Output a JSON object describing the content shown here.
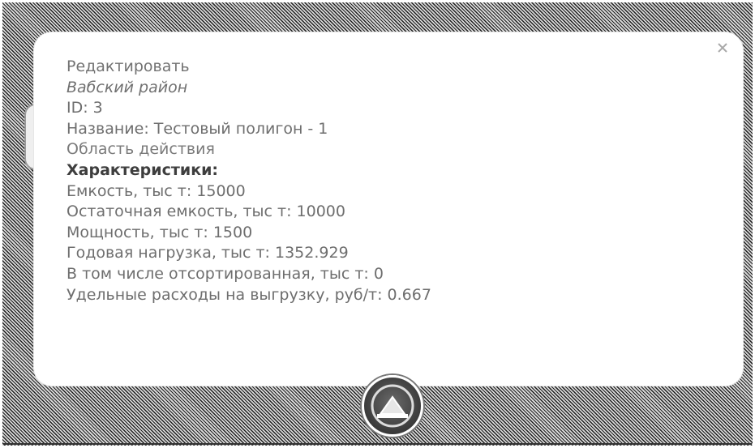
{
  "popup": {
    "edit_label": "Редактировать",
    "district": "Вабский район",
    "id_line": "ID: 3",
    "name_line": "Название: Тестовый полигон - 1",
    "scope_label": "Область действия",
    "characteristics_heading": "Характеристики:",
    "characteristics": [
      "Емкость, тыс т: 15000",
      "Остаточная емкость, тыс т: 10000",
      "Мощность, тыс т: 1500",
      "Годовая нагрузка, тыс т: 1352.929",
      "В том числе отсортированная, тыс т: 0",
      "Удельные расходы на выгрузку, руб/т: 0.667"
    ],
    "close_icon": "close-icon"
  },
  "map": {
    "marker_icon": "landfill-marker-icon"
  }
}
